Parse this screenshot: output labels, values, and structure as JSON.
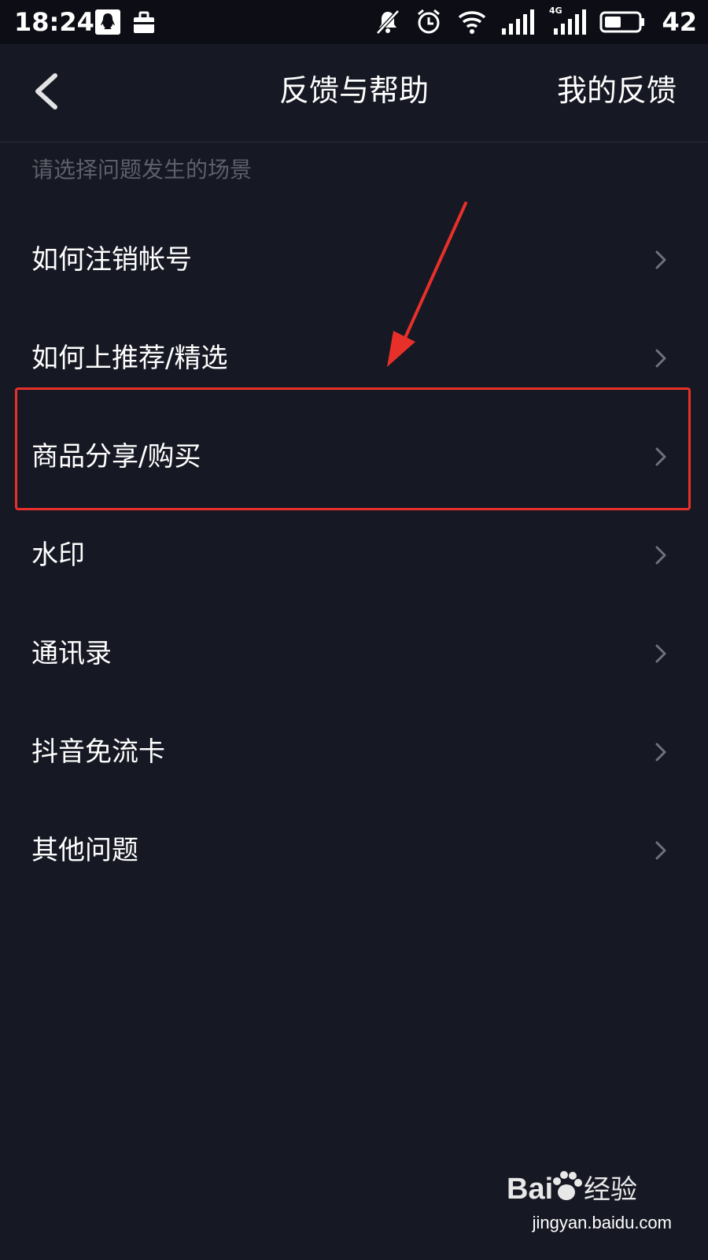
{
  "status_bar": {
    "time": "18:24",
    "battery_level": "42",
    "icons": [
      "qq-icon",
      "briefcase-icon",
      "mute-bell-icon",
      "alarm-icon",
      "wifi-icon",
      "signal-icon",
      "signal-4g-icon",
      "battery-icon"
    ],
    "network_label": "4G"
  },
  "nav": {
    "title": "反馈与帮助",
    "right_action": "我的反馈",
    "back_icon": "chevron-left-icon"
  },
  "section": {
    "header": "请选择问题发生的场景"
  },
  "items": [
    {
      "label": "如何注销帐号"
    },
    {
      "label": "如何上推荐/精选"
    },
    {
      "label": "商品分享/购买"
    },
    {
      "label": "水印"
    },
    {
      "label": "通讯录"
    },
    {
      "label": "抖音免流卡"
    },
    {
      "label": "其他问题"
    }
  ],
  "annotation": {
    "highlighted_item": "商品分享/购买",
    "color": "#e8302b"
  },
  "watermark": {
    "brand": "Baidu经验",
    "url": "jingyan.baidu.com"
  },
  "colors": {
    "background": "#161823",
    "status_bar": "#0d0e15",
    "text_primary": "#ffffff",
    "text_secondary": "#5d5f69",
    "chevron": "#6f717b"
  }
}
